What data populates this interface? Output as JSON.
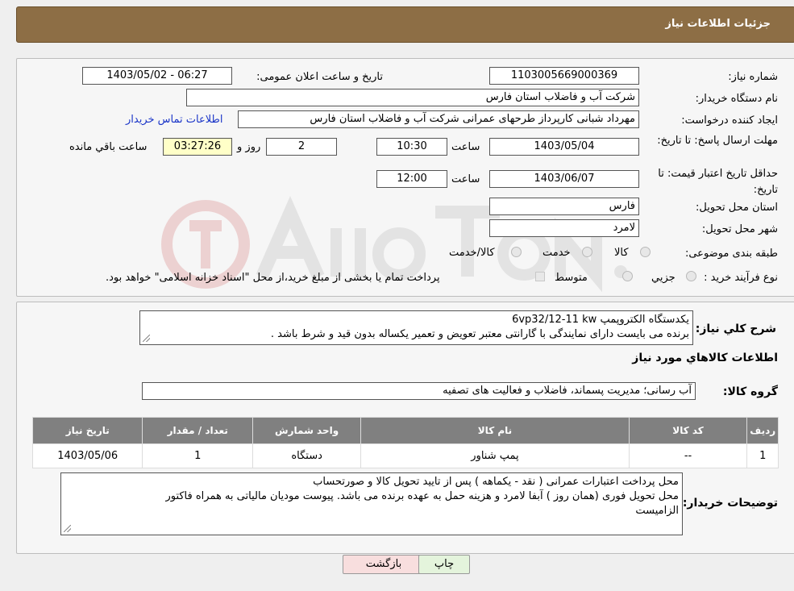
{
  "header": {
    "title": "جزئیات اطلاعات نیاز"
  },
  "fields": {
    "need_number_label": "شماره نیاز:",
    "need_number": "1103005669000369",
    "announce_label": "تاریخ و ساعت اعلان عمومی:",
    "announce_value": "1403/05/02 - 06:27",
    "buyer_org_label": "نام دستگاه خریدار:",
    "buyer_org": "شرکت آب و فاضلاب استان فارس",
    "creator_label": "ایجاد کننده درخواست:",
    "creator": "مهرداد شبانی کارپرداز طرحهای عمرانی  شرکت آب و فاضلاب استان فارس",
    "contact_link": "اطلاعات تماس خریدار",
    "reply_deadline_label": "مهلت ارسال پاسخ: تا تاریخ:",
    "reply_date": "1403/05/04",
    "time_label": "ساعت",
    "reply_time": "10:30",
    "days": "2",
    "days_label": "روز و",
    "remaining": "03:27:26",
    "remaining_label": "ساعت باقي مانده",
    "price_validity_label": "حداقل تاریخ اعتبار قیمت: تا تاریخ:",
    "price_date": "1403/06/07",
    "price_time": "12:00",
    "province_label": "استان محل تحویل:",
    "province": "فارس",
    "city_label": "شهر محل تحویل:",
    "city": "لامرد",
    "category_label": "طبقه بندی موضوعی:",
    "cat_goods": "کالا",
    "cat_service": "خدمت",
    "cat_both": "کالا/خدمت",
    "purchase_type_label": "نوع فرآیند خرید :",
    "pt_partial": "جزیي",
    "pt_medium": "متوسط",
    "pt_note": "پرداخت تمام یا بخشی از مبلغ خرید،از محل \"اسناد خزانه اسلامی\" خواهد بود."
  },
  "description": {
    "label": "شرح کلي نياز:",
    "line1": "یکدستگاه الکتروپمپ 6vp32/12-11 kw",
    "line2": "برنده می بایست دارای نمایندگی با گارانتی معتبر تعویض و تعمیر یکساله بدون قید و شرط باشد ."
  },
  "goods_section": {
    "title": "اطلاعات کالاهاي مورد نياز",
    "group_label": "گروه کالا:",
    "group_value": "آب رسانی؛ مدیریت پسماند، فاضلاب و فعالیت های تصفیه"
  },
  "table": {
    "headers": [
      "رديف",
      "کد کالا",
      "نام کالا",
      "واحد شمارش",
      "تعداد / مقدار",
      "تاریخ نیاز"
    ],
    "rows": [
      [
        "1",
        "--",
        "پمپ شناور",
        "دستگاه",
        "1",
        "1403/05/06"
      ]
    ]
  },
  "buyer_notes": {
    "label": "توضیحات خریدار:",
    "line1": "محل پرداخت اعتبارات عمرانی ( نقد - یکماهه ) پس از تایید تحویل کالا و صورتحساب",
    "line2": "محل تحویل فوری (همان روز ) آبفا  لامرد  و هزینه حمل به عهده برنده می باشد. پیوست مودیان مالیاتی به همراه فاکتور",
    "line3": "الزامیست"
  },
  "buttons": {
    "print": "چاپ",
    "back": "بازگشت"
  },
  "colors": {
    "header": "#8d6e45",
    "link": "#1a35c8",
    "back_button": "#f8dede",
    "print_button": "#e4f4dc"
  }
}
